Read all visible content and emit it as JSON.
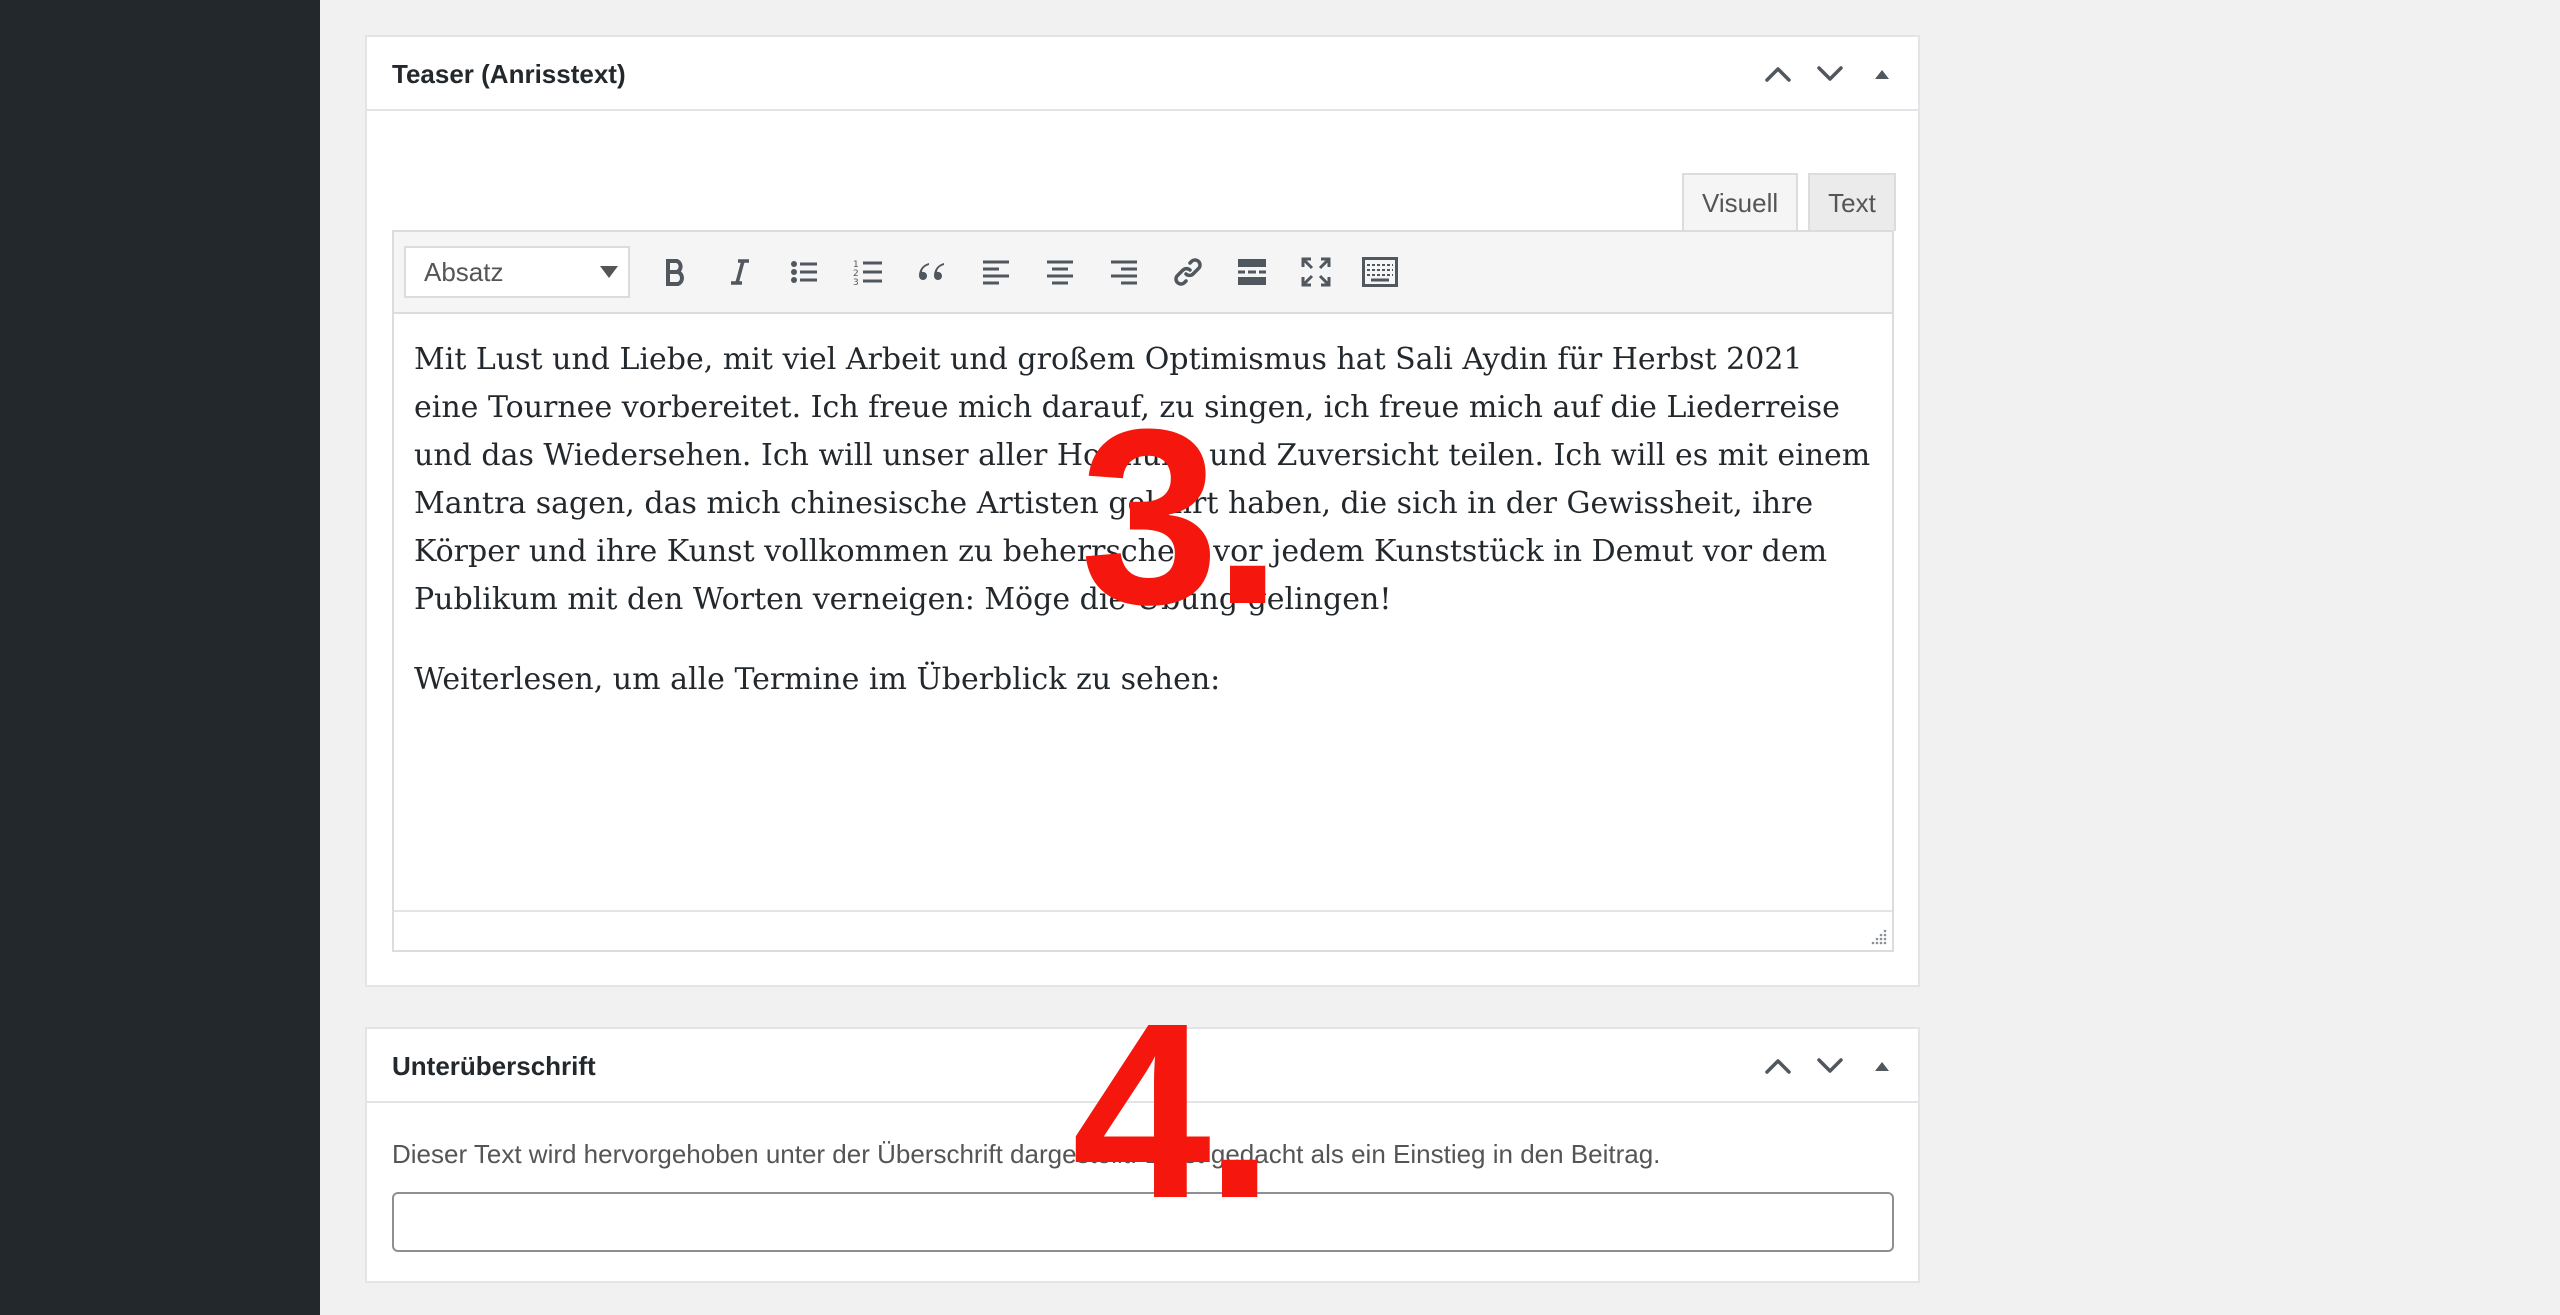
{
  "teaser": {
    "title": "Teaser (Anrisstext)",
    "tabs": [
      "Visuell",
      "Text"
    ],
    "format_select": "Absatz",
    "paragraphs": [
      "Mit Lust und Liebe, mit viel Arbeit und großem Optimismus hat Sali Aydin für Herbst 2021 eine Tournee vorbereitet. Ich freue mich darauf, zu singen, ich freue mich auf die Liederreise und das Wiedersehen. Ich will unser aller Hoffnung und Zuversicht teilen. Ich will es mit einem Mantra sagen, das mich chinesische Artisten gelehrt haben, die sich in der Gewissheit, ihre Körper und ihre Kunst vollkommen zu beherrschen, vor jedem Kunststück in Demut vor dem Publikum mit den Worten verneigen: Möge die Übung gelingen!",
      "Weiterlesen, um alle Termine im Überblick zu sehen:"
    ]
  },
  "subheading": {
    "title": "Unterüberschrift",
    "description": "Dieser Text wird hervorgehoben unter der Überschrift dargestellt. Er ist gedacht als ein Einstieg in den Beitrag.",
    "input_value": ""
  },
  "markers": {
    "step3": "3.",
    "step4": "4."
  },
  "icons": {
    "toolbar": [
      "bold-icon",
      "italic-icon",
      "bullet-list-icon",
      "numbered-list-icon",
      "blockquote-icon",
      "align-left-icon",
      "align-center-icon",
      "align-right-icon",
      "link-icon",
      "read-more-icon",
      "fullscreen-icon",
      "toolbar-toggle-icon"
    ],
    "handle": [
      "move-up-icon",
      "move-down-icon",
      "toggle-panel-icon"
    ]
  },
  "colors": {
    "sidebar": "#23282d",
    "marker": "#f5170e",
    "background": "#f1f1f1"
  }
}
